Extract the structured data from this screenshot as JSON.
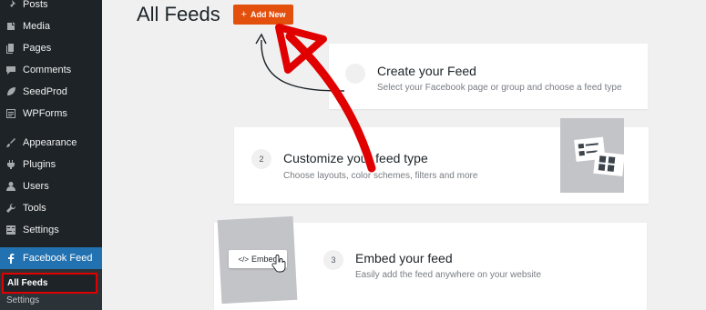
{
  "sidebar": {
    "items": [
      {
        "label": "Posts",
        "icon": "pushpin-icon"
      },
      {
        "label": "Media",
        "icon": "media-icon"
      },
      {
        "label": "Pages",
        "icon": "pages-icon"
      },
      {
        "label": "Comments",
        "icon": "comments-icon"
      },
      {
        "label": "SeedProd",
        "icon": "seedprod-leaf-icon"
      },
      {
        "label": "WPForms",
        "icon": "wpforms-icon"
      },
      {
        "label": "Appearance",
        "icon": "paintbrush-icon"
      },
      {
        "label": "Plugins",
        "icon": "plugins-icon"
      },
      {
        "label": "Users",
        "icon": "users-icon"
      },
      {
        "label": "Tools",
        "icon": "wrench-icon"
      },
      {
        "label": "Settings",
        "icon": "settings-icon"
      },
      {
        "label": "Facebook Feed",
        "icon": "facebook-icon",
        "active": true
      }
    ],
    "submenu": {
      "all_feeds": "All Feeds",
      "settings": "Settings"
    }
  },
  "header": {
    "title": "All Feeds",
    "add_new": "Add New"
  },
  "steps": [
    {
      "number": "",
      "title": "Create your Feed",
      "description": "Select your Facebook page or group and choose a feed type"
    },
    {
      "number": "2",
      "title": "Customize your feed type",
      "description": "Choose layouts, color schemes, filters and more"
    },
    {
      "number": "3",
      "title": "Embed your feed",
      "description": "Easily add the feed anywhere on your website"
    }
  ],
  "illustration": {
    "embed_label": "Embed",
    "code_glyph": "</>"
  },
  "colors": {
    "sidebar_bg": "#1d2327",
    "active_blue": "#2271b1",
    "add_new_orange": "#e34f0d",
    "annotation_red": "#e10000"
  }
}
